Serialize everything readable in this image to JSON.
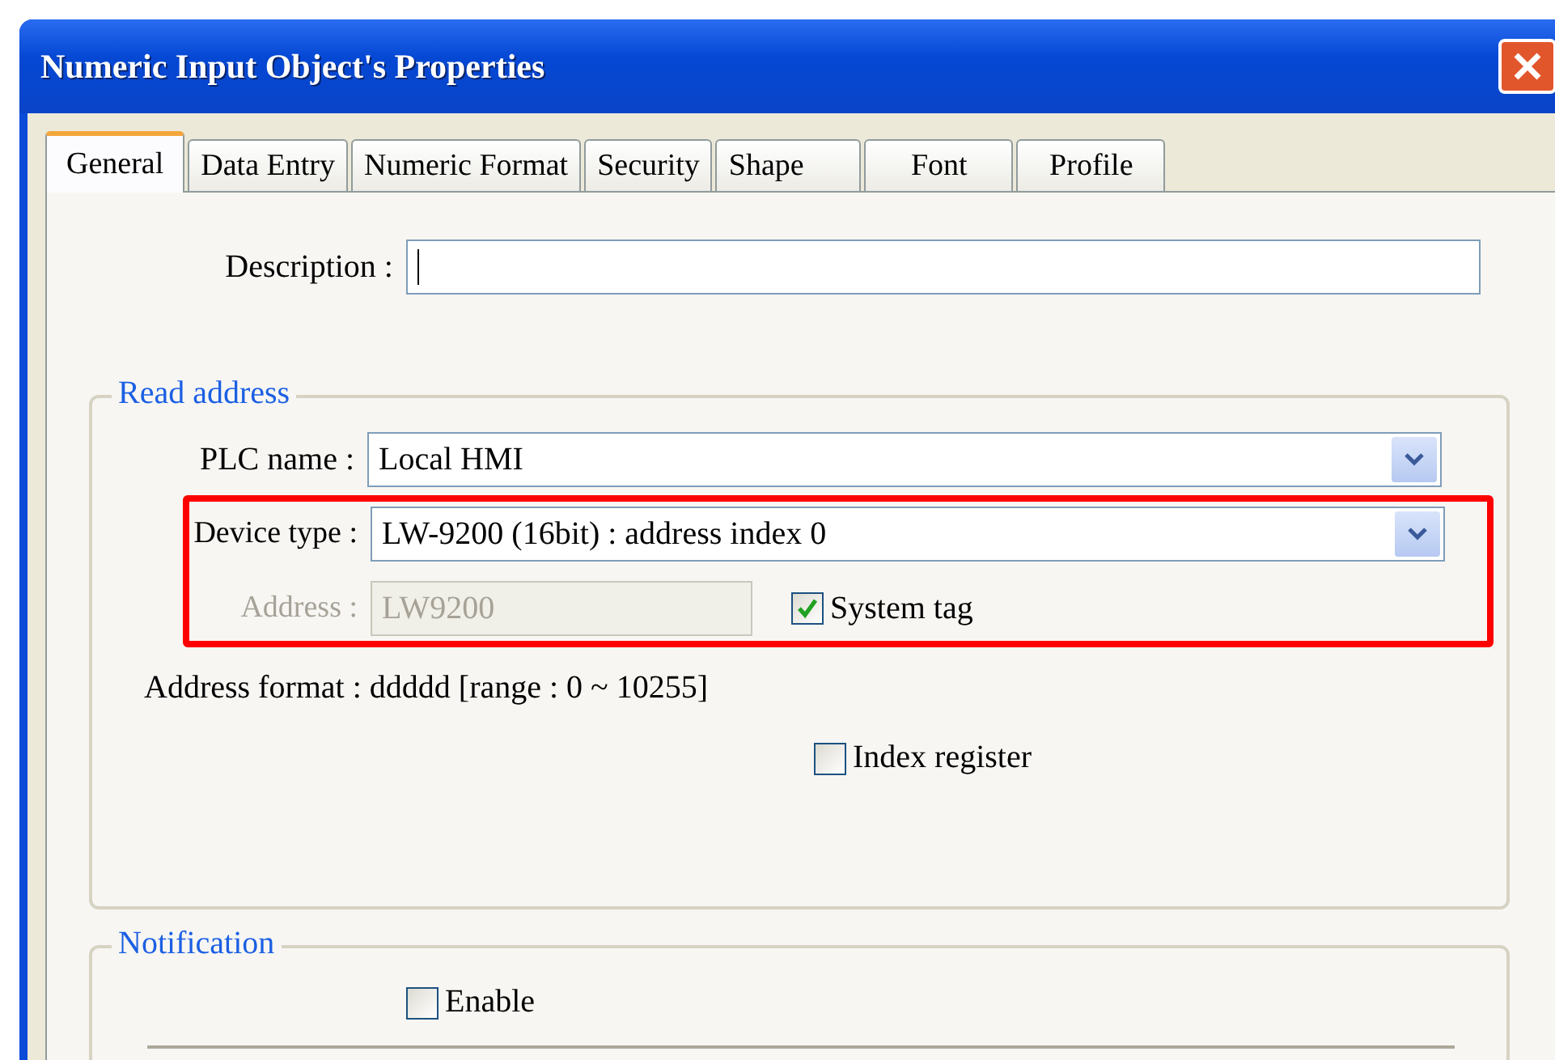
{
  "window": {
    "title": "Numeric Input Object's Properties"
  },
  "tabs": [
    {
      "label": "General",
      "selected": true
    },
    {
      "label": "Data Entry",
      "selected": false
    },
    {
      "label": "Numeric Format",
      "selected": false
    },
    {
      "label": "Security",
      "selected": false
    },
    {
      "label": "Shape",
      "selected": false
    },
    {
      "label": "Font",
      "selected": false
    },
    {
      "label": "Profile",
      "selected": false
    }
  ],
  "description": {
    "label": "Description :"
  },
  "read_address": {
    "title": "Read address",
    "plc_name": {
      "label": "PLC name :",
      "value": "Local HMI"
    },
    "device_type": {
      "label": "Device type :",
      "value": "LW-9200 (16bit) : address index 0"
    },
    "address": {
      "label": "Address :",
      "value": "LW9200",
      "disabled": true
    },
    "system_tag": {
      "label": "System tag",
      "checked": true
    },
    "address_format": "Address format : ddddd [range : 0 ~ 10255]",
    "index_register": {
      "label": "Index register",
      "checked": false
    }
  },
  "notification": {
    "title": "Notification",
    "enable": {
      "label": "Enable",
      "checked": false
    }
  }
}
